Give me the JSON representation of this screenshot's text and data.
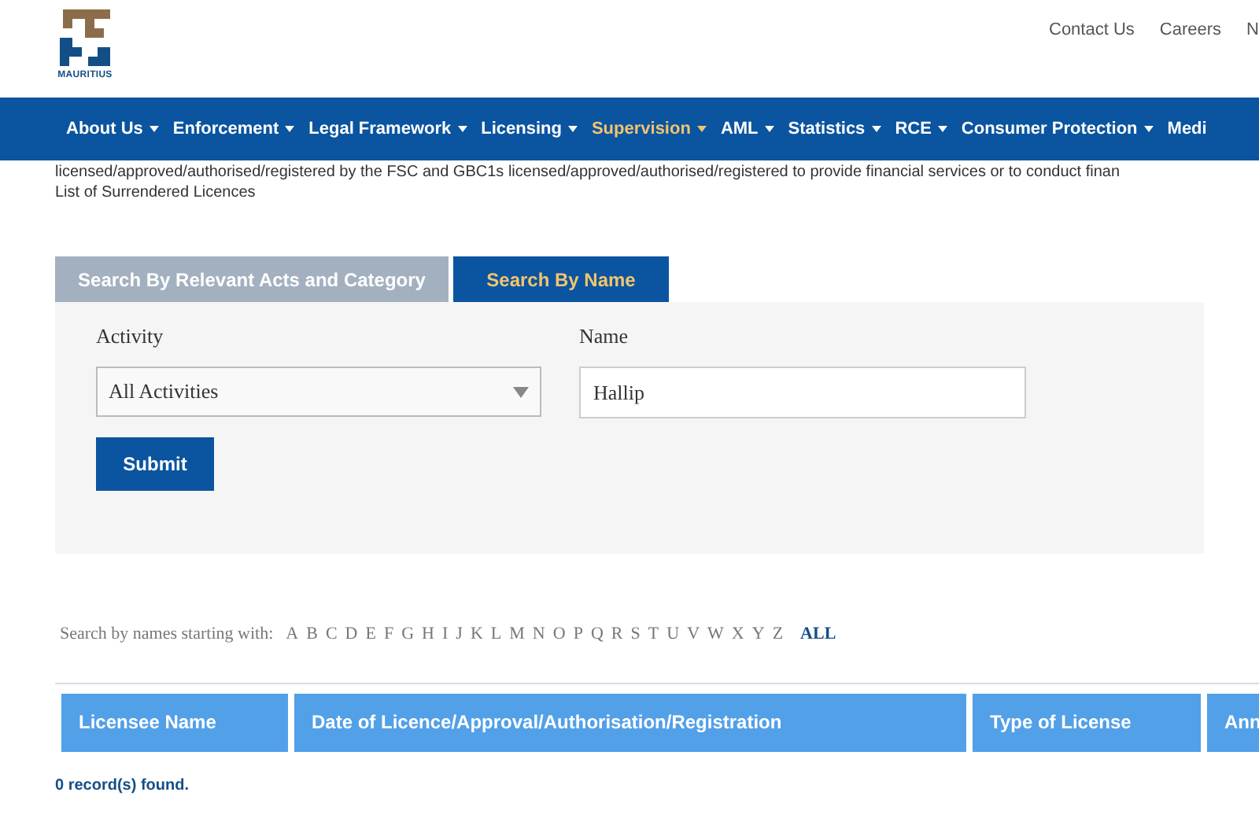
{
  "logo": {
    "caption": "MAURITIUS"
  },
  "top_links": [
    "Contact Us",
    "Careers",
    "N"
  ],
  "nav": [
    {
      "label": "About Us",
      "selected": false
    },
    {
      "label": "Enforcement",
      "selected": false
    },
    {
      "label": "Legal Framework",
      "selected": false
    },
    {
      "label": "Licensing",
      "selected": false
    },
    {
      "label": "Supervision",
      "selected": true
    },
    {
      "label": "AML",
      "selected": false
    },
    {
      "label": "Statistics",
      "selected": false
    },
    {
      "label": "RCE",
      "selected": false
    },
    {
      "label": "Consumer Protection",
      "selected": false
    },
    {
      "label": "Medi",
      "selected": false
    }
  ],
  "intro": [
    "licensed/approved/authorised/registered by the FSC and GBC1s licensed/approved/authorised/registered to provide financial services or to conduct finan",
    "List of Surrendered Licences"
  ],
  "tabs": [
    {
      "label": "Search By Relevant Acts and Category",
      "selected": false
    },
    {
      "label": "Search By Name",
      "selected": true
    }
  ],
  "form": {
    "activity_label": "Activity",
    "activity_value": "All Activities",
    "name_label": "Name",
    "name_value": "Hallip",
    "submit": "Submit"
  },
  "letters_label": "Search by names starting with:",
  "letters": [
    {
      "label": "A",
      "selected": false
    },
    {
      "label": "B",
      "selected": false
    },
    {
      "label": "C",
      "selected": false
    },
    {
      "label": "D",
      "selected": false
    },
    {
      "label": "E",
      "selected": false
    },
    {
      "label": "F",
      "selected": false
    },
    {
      "label": "G",
      "selected": false
    },
    {
      "label": "H",
      "selected": false
    },
    {
      "label": "I",
      "selected": false
    },
    {
      "label": "J",
      "selected": false
    },
    {
      "label": "K",
      "selected": false
    },
    {
      "label": "L",
      "selected": false
    },
    {
      "label": "M",
      "selected": false
    },
    {
      "label": "N",
      "selected": false
    },
    {
      "label": "O",
      "selected": false
    },
    {
      "label": "P",
      "selected": false
    },
    {
      "label": "Q",
      "selected": false
    },
    {
      "label": "R",
      "selected": false
    },
    {
      "label": "S",
      "selected": false
    },
    {
      "label": "T",
      "selected": false
    },
    {
      "label": "U",
      "selected": false
    },
    {
      "label": "V",
      "selected": false
    },
    {
      "label": "W",
      "selected": false
    },
    {
      "label": "X",
      "selected": false
    },
    {
      "label": "Y",
      "selected": false
    },
    {
      "label": "Z",
      "selected": false
    },
    {
      "label": "ALL",
      "selected": true
    }
  ],
  "table": {
    "columns": [
      "Licensee Name",
      "Date of Licence/Approval/Authorisation/Registration",
      "Type of License",
      "Ann"
    ]
  },
  "status": "0 record(s) found."
}
